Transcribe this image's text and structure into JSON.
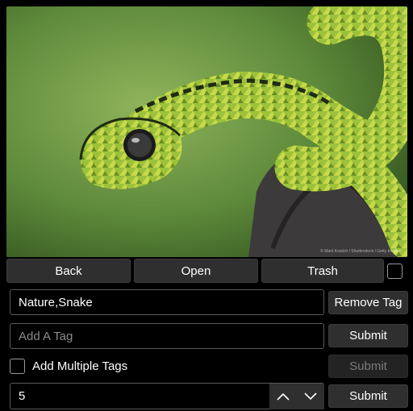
{
  "image": {
    "subject": "snake-photo",
    "credit": "© Mark Kostich / Shutterstock / Getty Images"
  },
  "nav": {
    "back_label": "Back",
    "open_label": "Open",
    "trash_label": "Trash"
  },
  "tags": {
    "current_value": "Nature,Snake",
    "remove_label": "Remove Tag",
    "add_placeholder": "Add A Tag",
    "submit_label": "Submit"
  },
  "multi": {
    "checkbox_label": "Add Multiple Tags",
    "submit_label": "Submit",
    "count_value": "5",
    "count_submit_label": "Submit"
  },
  "icons": {
    "up": "chevron-up-icon",
    "down": "chevron-down-icon"
  },
  "colors": {
    "background": "#000000",
    "button": "#2f2f2f",
    "button_disabled": "#232323",
    "field_border": "#5a5a5a",
    "placeholder": "#8a8a8a"
  }
}
